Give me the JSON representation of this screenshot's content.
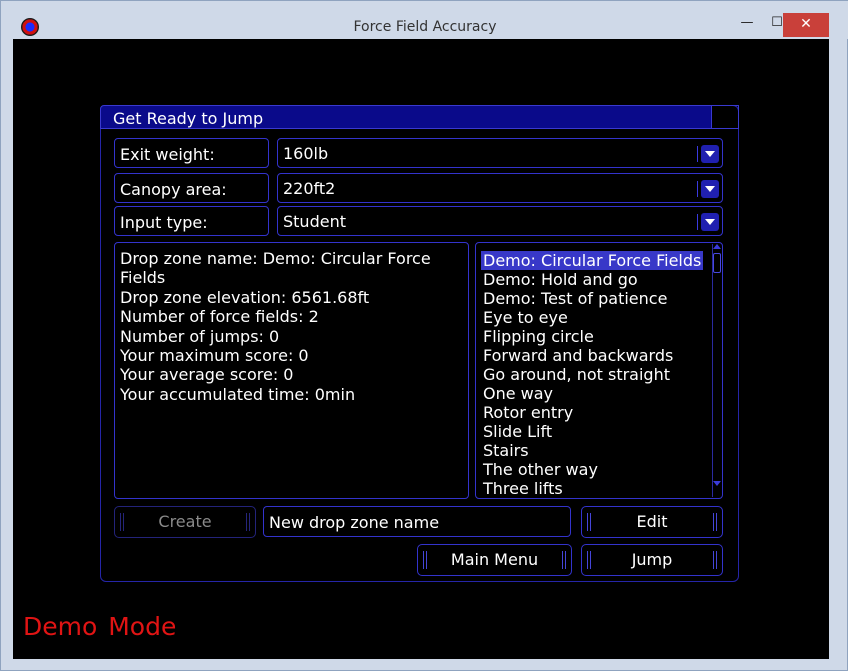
{
  "window": {
    "title": "Force Field Accuracy",
    "minimize_glyph": "—",
    "maximize_glyph": "☐",
    "close_glyph": "✕"
  },
  "panel": {
    "title": "Get Ready to Jump"
  },
  "fields": [
    {
      "label": "Exit weight:",
      "value": "160lb"
    },
    {
      "label": "Canopy area:",
      "value": "220ft2"
    },
    {
      "label": "Input type:",
      "value": "Student"
    }
  ],
  "info": {
    "lines": [
      "Drop zone name: Demo: Circular Force",
      "Fields",
      "Drop zone elevation: 6561.68ft",
      "Number of force fields: 2",
      "Number of jumps: 0",
      "Your maximum score: 0",
      "Your average score: 0",
      "Your accumulated time: 0min"
    ]
  },
  "dropzones": {
    "selected_index": 0,
    "items": [
      "Demo: Circular Force Fields",
      "Demo: Hold and go",
      "Demo: Test of patience",
      "Eye to eye",
      "Flipping circle",
      "Forward and backwards",
      "Go around, not straight",
      "One way",
      "Rotor entry",
      "Slide Lift",
      "Stairs",
      "The other way",
      "Three lifts"
    ]
  },
  "actions": {
    "create_label": "Create",
    "new_name_value": "New drop zone name",
    "edit_label": "Edit",
    "main_menu_label": "Main Menu",
    "jump_label": "Jump"
  },
  "status": {
    "mode_text": "Demo  Mode"
  },
  "colors": {
    "accent": "#3333cc",
    "header": "#0a0a8a",
    "selection": "#3838c8",
    "demo_mode": "#e01414"
  }
}
